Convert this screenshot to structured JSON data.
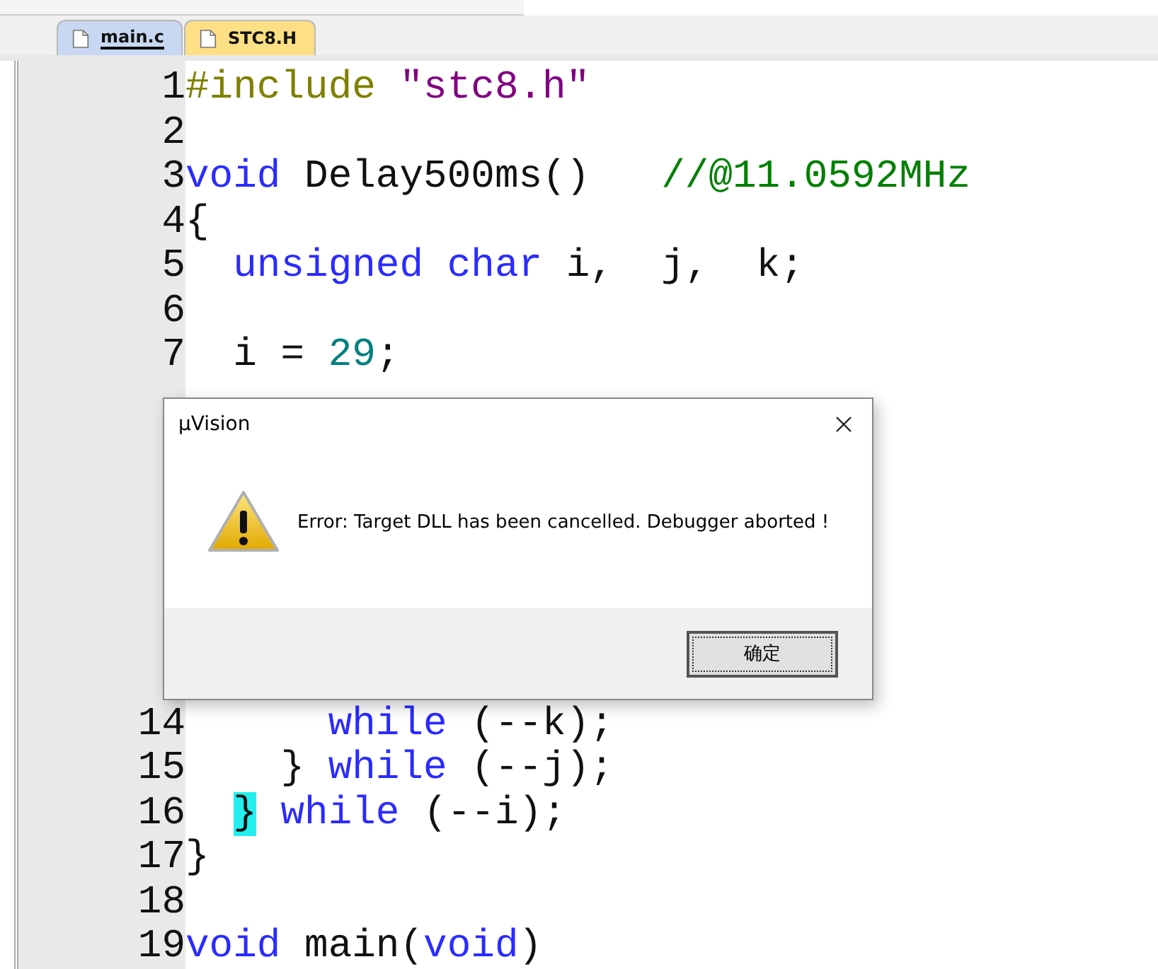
{
  "tabs": [
    {
      "label": "main.c",
      "selected": true
    },
    {
      "label": "STC8.H",
      "selected": false
    }
  ],
  "code_top": [
    {
      "number": "1",
      "tokens": [
        {
          "kind": "preprocessor",
          "text": "#include "
        },
        {
          "kind": "string",
          "text": "\"stc8.h\""
        }
      ]
    },
    {
      "number": "2"
    },
    {
      "number": "3",
      "tokens": [
        {
          "kind": "keyword",
          "text": "void"
        },
        {
          "kind": "plain",
          "text": " Delay500ms()   "
        },
        {
          "kind": "comment",
          "text": "//@11.0592MHz"
        }
      ]
    },
    {
      "number": "4",
      "tokens": [
        {
          "kind": "plain",
          "text": "{"
        }
      ]
    },
    {
      "number": "5",
      "tokens": [
        {
          "kind": "keyword",
          "text": "  unsigned"
        },
        {
          "kind": "keyword",
          "text": " char"
        },
        {
          "kind": "plain",
          "text": " i,  j,  k;"
        }
      ]
    },
    {
      "number": "6"
    },
    {
      "number": "7",
      "tokens": [
        {
          "kind": "plain",
          "text": "  i = "
        },
        {
          "kind": "number",
          "text": "29"
        },
        {
          "kind": "plain",
          "text": ";"
        }
      ]
    }
  ],
  "code_bottom": [
    {
      "number": "14",
      "tokens": [
        {
          "kind": "keyword",
          "text": "      while"
        },
        {
          "kind": "plain",
          "text": " (--k);"
        }
      ]
    },
    {
      "number": "15",
      "tokens": [
        {
          "kind": "plain",
          "text": "    } "
        },
        {
          "kind": "keyword",
          "text": "while"
        },
        {
          "kind": "plain",
          "text": " (--j);"
        }
      ]
    },
    {
      "number": "16",
      "tokens": [
        {
          "kind": "brace-match",
          "text": "  }"
        },
        {
          "kind": "keyword",
          "text": " while"
        },
        {
          "kind": "plain",
          "text": " (--i);"
        }
      ]
    },
    {
      "number": "17",
      "tokens": [
        {
          "kind": "plain",
          "text": "}"
        }
      ]
    },
    {
      "number": "18"
    },
    {
      "number": "19",
      "tokens": [
        {
          "kind": "keyword",
          "text": "void"
        },
        {
          "kind": "plain",
          "text": " main("
        },
        {
          "kind": "keyword",
          "text": "void"
        },
        {
          "kind": "plain",
          "text": ")"
        }
      ]
    }
  ],
  "dialog": {
    "title": "µVision",
    "message": "Error: Target DLL has been cancelled. Debugger aborted !",
    "button": "确定"
  }
}
